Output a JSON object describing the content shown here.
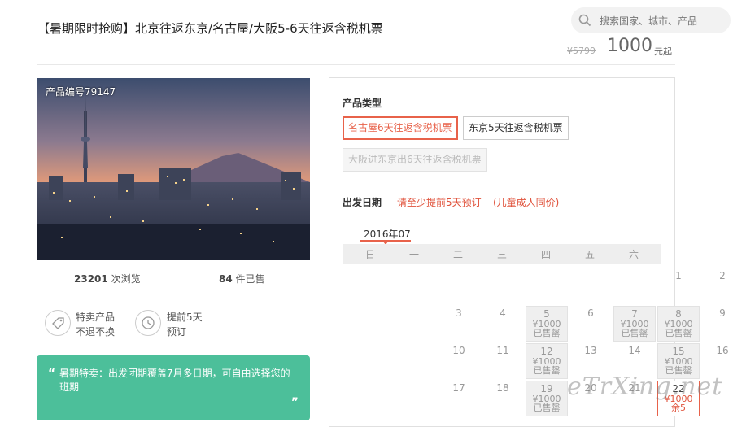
{
  "header": {
    "title": "【暑期限时抢购】北京往返东京/名古屋/大阪5-6天往返含税机票",
    "search_placeholder": "搜索国家、城市、产品",
    "old_price": "¥5799",
    "price": "1000",
    "price_unit": "元起"
  },
  "product": {
    "number": "产品编号79147",
    "views_count": "23201",
    "views_label": "次浏览",
    "sold_count": "84",
    "sold_label": "件已售",
    "features": [
      {
        "icon": "tag-icon",
        "line1": "特卖产品",
        "line2": "不退不换"
      },
      {
        "icon": "clock-icon",
        "line1": "提前5天",
        "line2": "预订"
      }
    ],
    "promo_text": "暑期特卖：出发团期覆盖7月多日期，可自由选择您的班期"
  },
  "booking": {
    "type_label": "产品类型",
    "types": [
      {
        "label": "名古屋6天往返含税机票",
        "state": "selected"
      },
      {
        "label": "东京5天往返含税机票",
        "state": "normal"
      },
      {
        "label": "大阪进东京出6天往返含税机票",
        "state": "disabled"
      }
    ],
    "date_label": "出发日期",
    "note1": "请至少提前5天预订",
    "note2": "(儿童成人同价)",
    "month": "2016年07",
    "weekdays": [
      "日",
      "一",
      "二",
      "三",
      "四",
      "五",
      "六"
    ],
    "days": [
      {
        "d": "1",
        "p": "",
        "s": "",
        "st": "plain"
      },
      {
        "d": "2",
        "p": "",
        "s": "",
        "st": "plain"
      },
      {
        "d": "3",
        "p": "",
        "s": "",
        "st": "plain"
      },
      {
        "d": "4",
        "p": "",
        "s": "",
        "st": "plain"
      },
      {
        "d": "5",
        "p": "¥1000",
        "s": "已售罄",
        "st": "soldout"
      },
      {
        "d": "6",
        "p": "",
        "s": "",
        "st": "plain"
      },
      {
        "d": "7",
        "p": "¥1000",
        "s": "已售罄",
        "st": "soldout"
      },
      {
        "d": "8",
        "p": "¥1000",
        "s": "已售罄",
        "st": "soldout"
      },
      {
        "d": "9",
        "p": "",
        "s": "",
        "st": "plain"
      },
      {
        "d": "10",
        "p": "",
        "s": "",
        "st": "plain"
      },
      {
        "d": "11",
        "p": "",
        "s": "",
        "st": "plain"
      },
      {
        "d": "12",
        "p": "¥1000",
        "s": "已售罄",
        "st": "soldout"
      },
      {
        "d": "13",
        "p": "",
        "s": "",
        "st": "plain"
      },
      {
        "d": "14",
        "p": "",
        "s": "",
        "st": "plain"
      },
      {
        "d": "15",
        "p": "¥1000",
        "s": "已售罄",
        "st": "soldout"
      },
      {
        "d": "16",
        "p": "",
        "s": "",
        "st": "plain"
      },
      {
        "d": "17",
        "p": "",
        "s": "",
        "st": "plain"
      },
      {
        "d": "18",
        "p": "",
        "s": "",
        "st": "plain"
      },
      {
        "d": "19",
        "p": "¥1000",
        "s": "已售罄",
        "st": "soldout"
      },
      {
        "d": "20",
        "p": "",
        "s": "",
        "st": "plain"
      },
      {
        "d": "21",
        "p": "",
        "s": "",
        "st": "plain"
      },
      {
        "d": "22",
        "p": "¥1000",
        "s": "余5",
        "st": "available"
      }
    ]
  },
  "watermark": "eTrXing.net",
  "colors": {
    "accent": "#e8624a",
    "promo_bg": "#4cbf9a"
  }
}
